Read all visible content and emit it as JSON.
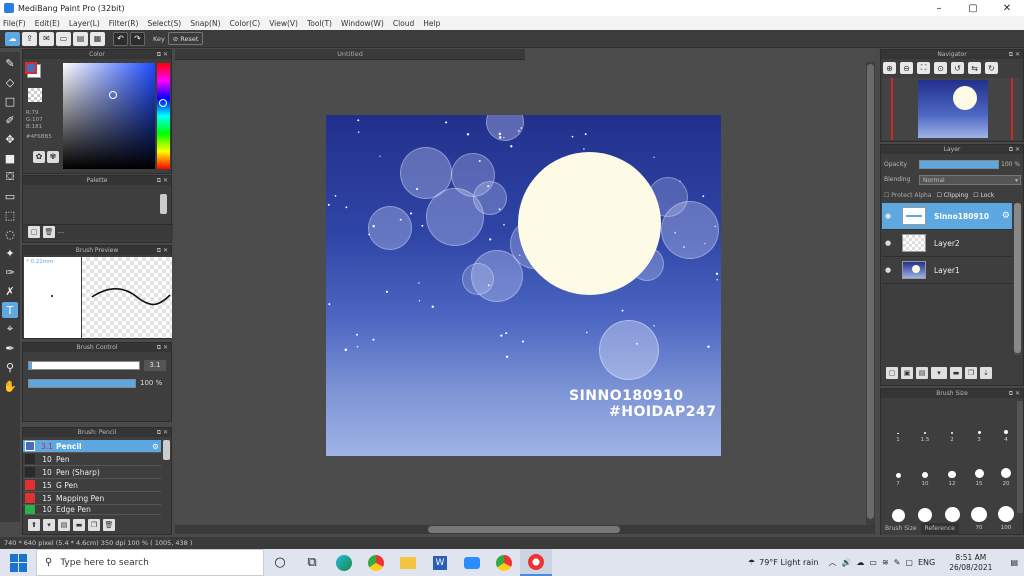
{
  "window": {
    "title": "MediBang Paint Pro (32bit)",
    "controls": [
      "–",
      "▢",
      "✕"
    ]
  },
  "menu": [
    "File(F)",
    "Edit(E)",
    "Layer(L)",
    "Filter(R)",
    "Select(S)",
    "Snap(N)",
    "Color(C)",
    "View(V)",
    "Tool(T)",
    "Window(W)",
    "Cloud",
    "Help"
  ],
  "toolbar": {
    "key_label": "Key",
    "reset_label": "Reset"
  },
  "document": {
    "tab": "Untitled"
  },
  "artwork": {
    "watermark_line1": "SINNO180910",
    "watermark_line2": "#HOIDAP247",
    "bg_top": "#22308c",
    "bg_bottom": "#9fb3e6",
    "moon": "#fdfbe6"
  },
  "color_panel": {
    "title": "Color",
    "r": "R:79",
    "g": "G:107",
    "b": "B:181",
    "hex": "#4F6BB5",
    "primary": "#4f6bb5",
    "secondary": "#ffffff"
  },
  "palette_panel": {
    "title": "Palette",
    "empty_label": "---"
  },
  "brush_preview": {
    "title": "Brush Preview",
    "size": "* 0.22mm"
  },
  "brush_control": {
    "title": "Brush Control",
    "size_value": "3.1",
    "opacity_value": "100 %",
    "size_fraction": 0.03,
    "opacity_fraction": 1.0
  },
  "brush_list": {
    "title": "Brush: Pencil",
    "items": [
      {
        "size": "3.1",
        "name": "Pencil",
        "color": "#4f6bb5"
      },
      {
        "size": "10",
        "name": "Pen",
        "color": "#2a2a2a"
      },
      {
        "size": "10",
        "name": "Pen (Sharp)",
        "color": "#2a2a2a"
      },
      {
        "size": "15",
        "name": "G Pen",
        "color": "#e03030"
      },
      {
        "size": "15",
        "name": "Mapping Pen",
        "color": "#e03030"
      },
      {
        "size": "10",
        "name": "Edge Pen",
        "color": "#2ab04a"
      }
    ]
  },
  "navigator": {
    "title": "Navigator"
  },
  "layer_panel": {
    "title": "Layer",
    "opacity_label": "Opacity",
    "opacity_value": "100 %",
    "blending_label": "Blending",
    "blending_value": "Normal",
    "protect_alpha": "Protect Alpha",
    "clipping": "Clipping",
    "lock": "Lock",
    "layers": [
      {
        "name": "Sinno180910",
        "selected": true
      },
      {
        "name": "Layer2",
        "selected": false
      },
      {
        "name": "Layer1",
        "selected": false
      }
    ]
  },
  "brush_size_panel": {
    "title": "Brush Size",
    "sizes": [
      "1",
      "1.5",
      "2",
      "3",
      "4",
      "7",
      "10",
      "12",
      "15",
      "20",
      "30",
      "40",
      "50",
      "70",
      "100"
    ],
    "tab_brush_size": "Brush Size",
    "tab_reference": "Reference"
  },
  "status": {
    "text": "740 * 640 pixel  (5.4 * 4.6cm)  350 dpi  100 %  ( 1005, 438 )"
  },
  "taskbar": {
    "search_placeholder": "Type here to search",
    "weather": "79°F  Light rain",
    "lang": "ENG",
    "time": "8:51 AM",
    "date": "26/08/2021"
  }
}
